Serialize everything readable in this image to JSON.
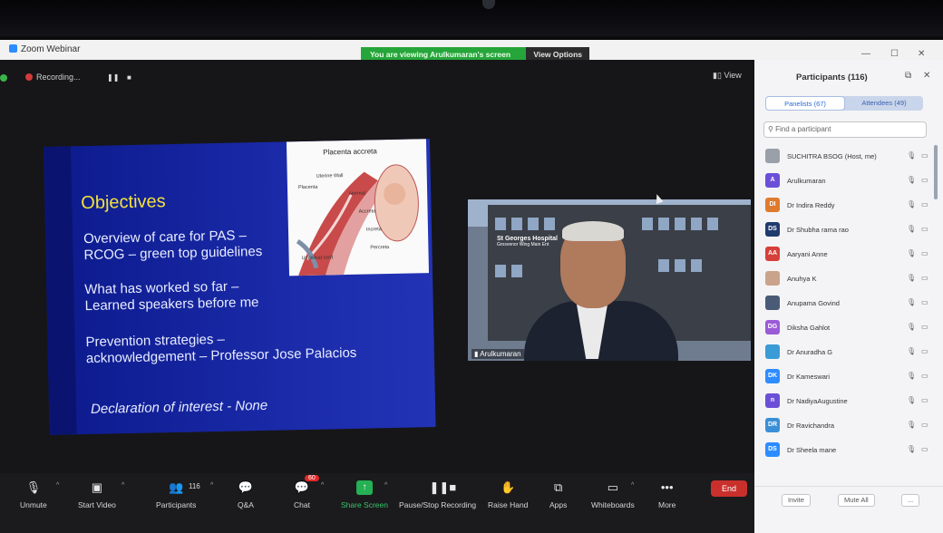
{
  "window": {
    "title": "Zoom Webinar",
    "viewing_banner": "You are viewing Arulkumaran's screen",
    "view_options": "View Options"
  },
  "stage": {
    "recording_label": "Recording...",
    "view_label": "View"
  },
  "slide": {
    "title": "Objectives",
    "lines": [
      "Overview of care for PAS –",
      "RCOG – green top guidelines",
      "What has worked so far –",
      "Learned speakers before me",
      "Prevention strategies –",
      "acknowledgement – Professor Jose Palacios"
    ],
    "declaration": "Declaration of interest - None",
    "diagram": {
      "title": "Placenta accreta",
      "labels": [
        "Uterine Wall",
        "Placenta",
        "Normal",
        "Accreta",
        "Increta",
        "Umbilical cord",
        "Percreta"
      ]
    }
  },
  "video": {
    "name": "Arulkumaran",
    "sign_line1": "St Georges Hospital",
    "sign_line2": "Grosvenor Wing Main Ent"
  },
  "toolbar": {
    "unmute": "Unmute",
    "start_video": "Start Video",
    "participants": "Participants",
    "participants_count": "116",
    "qa": "Q&A",
    "chat": "Chat",
    "chat_badge": "60",
    "share_screen": "Share Screen",
    "pause_recording": "Pause/Stop Recording",
    "raise_hand": "Raise Hand",
    "apps": "Apps",
    "whiteboards": "Whiteboards",
    "more": "More",
    "end": "End"
  },
  "panel": {
    "title": "Participants (116)",
    "tab_panelists": "Panelists (67)",
    "tab_attendees": "Attendees (49)",
    "search_placeholder": "Find a participant",
    "invite": "Invite",
    "mute_all": "Mute All",
    "more": "...",
    "participants": [
      {
        "initials": "",
        "name": "SUCHITRA BSOG (Host, me)",
        "color": "#9aa0aa"
      },
      {
        "initials": "A",
        "name": "Arulkumaran",
        "color": "#6b4fd8"
      },
      {
        "initials": "DI",
        "name": "Dr Indira Reddy",
        "color": "#e07b2d"
      },
      {
        "initials": "DS",
        "name": "Dr Shubha rama rao",
        "color": "#1f3a6e"
      },
      {
        "initials": "AA",
        "name": "Aaryani Anne",
        "color": "#d6403a"
      },
      {
        "initials": "",
        "name": "Anuhya K",
        "color": "#c9a38a"
      },
      {
        "initials": "",
        "name": "Anupama Govind",
        "color": "#4a5b78"
      },
      {
        "initials": "DG",
        "name": "Diksha Gahlot",
        "color": "#9b5bd6"
      },
      {
        "initials": "",
        "name": "Dr Anuradha G",
        "color": "#3a9bd6"
      },
      {
        "initials": "DK",
        "name": "Dr Kameswari",
        "color": "#2d8cff"
      },
      {
        "initials": "n",
        "name": "Dr NadiyaAugustine",
        "color": "#6b4fd8"
      },
      {
        "initials": "DR",
        "name": "Dr Ravichandra",
        "color": "#3a8fd6"
      },
      {
        "initials": "DS",
        "name": "Dr Sheela mane",
        "color": "#2d8cff"
      }
    ]
  }
}
